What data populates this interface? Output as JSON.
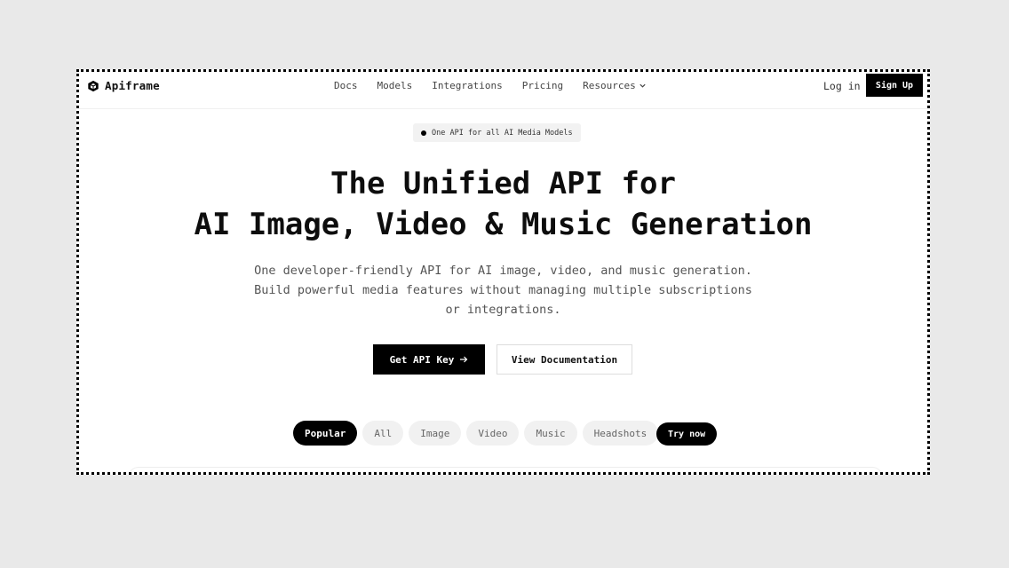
{
  "brand": {
    "name": "Apiframe",
    "icon": "cube-logo-icon"
  },
  "nav": {
    "links": [
      "Docs",
      "Models",
      "Integrations",
      "Pricing",
      "Resources"
    ],
    "resources_icon": "chevron-down-icon",
    "login": "Log in",
    "signup": "Sign Up"
  },
  "hero": {
    "badge": "One API for all AI Media Models",
    "headline_line1": "The Unified API for",
    "headline_line2": "AI Image, Video & Music Generation",
    "sub_line1": "One developer-friendly API for AI image, video, and music generation.",
    "sub_line2": "Build powerful media features without managing multiple subscriptions",
    "sub_line3": "or integrations.",
    "primary_button": "Get API Key",
    "primary_button_icon": "arrow-right-icon",
    "secondary_button": "View Documentation"
  },
  "filters": {
    "tabs": [
      "Popular",
      "All",
      "Image",
      "Video",
      "Music",
      "Headshots"
    ],
    "active": "Popular",
    "try_now": "Try now"
  }
}
